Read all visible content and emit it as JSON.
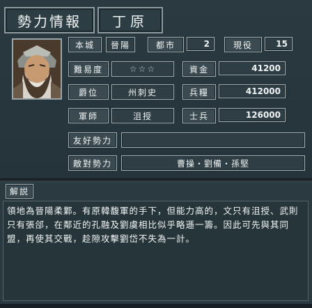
{
  "title": "勢力情報",
  "ruler_name": "丁原",
  "portrait_icon": "bearded-general-portrait",
  "fields": {
    "castle_label": "本城",
    "castle_value": "晉陽",
    "cities_label": "都市",
    "cities_value": "2",
    "officers_label": "現役",
    "officers_value": "15",
    "difficulty_label": "難易度",
    "difficulty_value": "☆☆☆",
    "funds_label": "資金",
    "funds_value": "41200",
    "rank_label": "爵位",
    "rank_value": "州刺史",
    "food_label": "兵糧",
    "food_value": "412000",
    "strategist_label": "軍師",
    "strategist_value": "沮授",
    "troops_label": "士兵",
    "troops_value": "126000",
    "allies_label": "友好勢力",
    "allies_value": "",
    "enemies_label": "敵對勢力",
    "enemies_value": "曹操・劉備・孫堅"
  },
  "description_label": "解説",
  "description": "領地為晉陽柔鄴。有原韓馥軍的手下，但能力高的，文只有沮授、武則只有張郃，在鄰近的孔融及劉虞相比似乎略遜一籌。因此可先與其同盟，再使其交戰，趁隙攻擊劉岱不失為一計。",
  "colors": {
    "background": "#233237",
    "panel_border": "#a6b2b6",
    "label_bg": "#3b4a50",
    "value_bg": "#2e3e44"
  }
}
